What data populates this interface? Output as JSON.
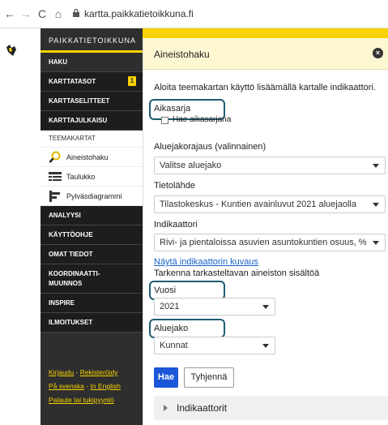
{
  "browser": {
    "url": "kartta.paikkatietoikkuna.fi",
    "back_icon": "←",
    "forward_icon": "→",
    "reload_icon": "C",
    "home_icon": "⌂"
  },
  "sidebar": {
    "brand": "PAIKKATIETOIKKUNA",
    "items": [
      {
        "label": "HAKU"
      },
      {
        "label": "KARTTATASOT",
        "badge": "1"
      },
      {
        "label": "KARTTASELITTEET"
      },
      {
        "label": "KARTTAJULKAISU"
      }
    ],
    "section": "TEEMAKARTAT",
    "subitems": [
      {
        "label": "Aineistohaku",
        "icon": "search-icon"
      },
      {
        "label": "Taulukko",
        "icon": "table-icon"
      },
      {
        "label": "Pylväsdiagrammi",
        "icon": "bar-chart-icon"
      }
    ],
    "items2": [
      {
        "label": "ANALYYSI"
      },
      {
        "label": "KÄYTTÖOHJE"
      },
      {
        "label": "OMAT TIEDOT"
      },
      {
        "label": "KOORDINAATTI-\nMUUNNOS"
      },
      {
        "label": "INSPIRE"
      },
      {
        "label": "ILMOITUKSET"
      }
    ],
    "links": {
      "login": "Kirjaudu",
      "register": "Rekisteröidy",
      "swedish": "På svenska",
      "english": "In English",
      "feedback": "Palaute tai tukipyyntö",
      "sep": " - "
    }
  },
  "panel": {
    "title": "Aineistohaku",
    "close": "×",
    "intro": "Aloita teemakartan käyttö lisäämällä kartalle indikaattori.",
    "series_label": "Aikasarja",
    "series_checkbox": "Hae aikasarjana",
    "region_label": "Aluejakorajaus (valinnainen)",
    "region_value": "Valitse aluejako",
    "source_label": "Tietolähde",
    "source_value": "Tilastokeskus - Kuntien avainluvut 2021 aluejaolla",
    "indicator_label": "Indikaattori",
    "indicator_value": "Rivi- ja pientaloissa asuvien asuntokuntien osuus, %",
    "description_link": "Näytä indikaattorin kuvaus",
    "refine_label": "Tarkenna tarkasteltavan aineiston sisältöä",
    "year_label": "Vuosi",
    "year_value": "2021",
    "division_label": "Aluejako",
    "division_value": "Kunnat",
    "search_button": "Hae",
    "clear_button": "Tyhjennä",
    "indicators_section": "Indikaattorit"
  }
}
